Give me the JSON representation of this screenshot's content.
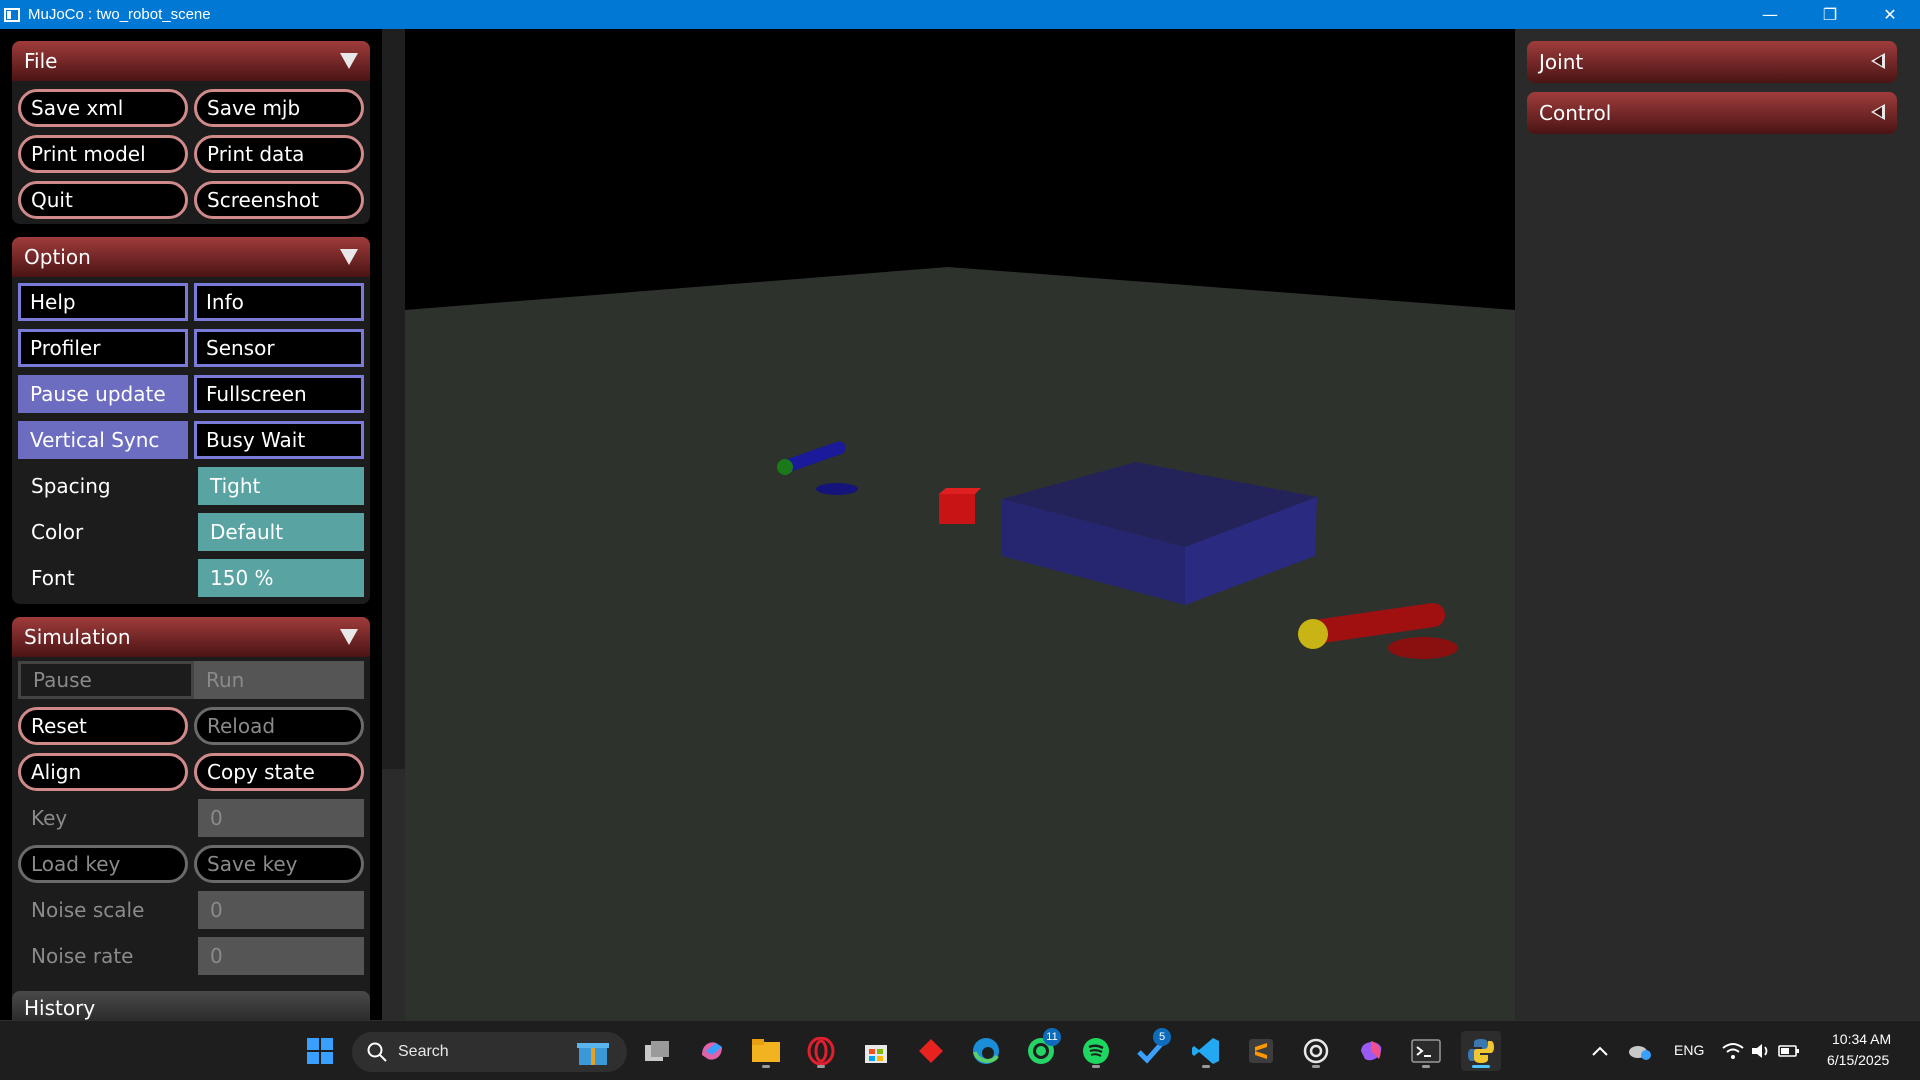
{
  "window": {
    "title": "MuJoCo : two_robot_scene",
    "minimize": "—",
    "maximize": "❐",
    "close": "✕"
  },
  "left": {
    "file": {
      "header": "File",
      "buttons": [
        "Save xml",
        "Save mjb",
        "Print model",
        "Print data",
        "Quit",
        "Screenshot"
      ]
    },
    "option": {
      "header": "Option",
      "toggles": [
        {
          "label": "Help",
          "on": false
        },
        {
          "label": "Info",
          "on": false
        },
        {
          "label": "Profiler",
          "on": false
        },
        {
          "label": "Sensor",
          "on": false
        },
        {
          "label": "Pause update",
          "on": true
        },
        {
          "label": "Fullscreen",
          "on": false
        },
        {
          "label": "Vertical Sync",
          "on": true
        },
        {
          "label": "Busy Wait",
          "on": false
        }
      ],
      "spacing_label": "Spacing",
      "spacing_value": "Tight",
      "color_label": "Color",
      "color_value": "Default",
      "font_label": "Font",
      "font_value": "150 %"
    },
    "simulation": {
      "header": "Simulation",
      "pause": "Pause",
      "run": "Run",
      "reset": "Reset",
      "reload": "Reload",
      "align": "Align",
      "copy_state": "Copy state",
      "key_label": "Key",
      "key_value": "0",
      "load_key": "Load key",
      "save_key": "Save key",
      "noise_scale_label": "Noise scale",
      "noise_scale_value": "0",
      "noise_rate_label": "Noise rate",
      "noise_rate_value": "0"
    },
    "history": {
      "header": "History"
    }
  },
  "right": {
    "joint": "Joint",
    "control": "Control"
  },
  "taskbar": {
    "search_placeholder": "Search",
    "whatsapp_badge": "11",
    "todo_badge": "5",
    "language": "ENG",
    "time": "10:34 AM",
    "date": "6/15/2025"
  },
  "colors": {
    "accent": "#0078d4",
    "section_header": "#a03c3c",
    "toggle_on": "#6c6cc0",
    "select_bg": "#5aa3a3",
    "floor": "#2d322d"
  }
}
